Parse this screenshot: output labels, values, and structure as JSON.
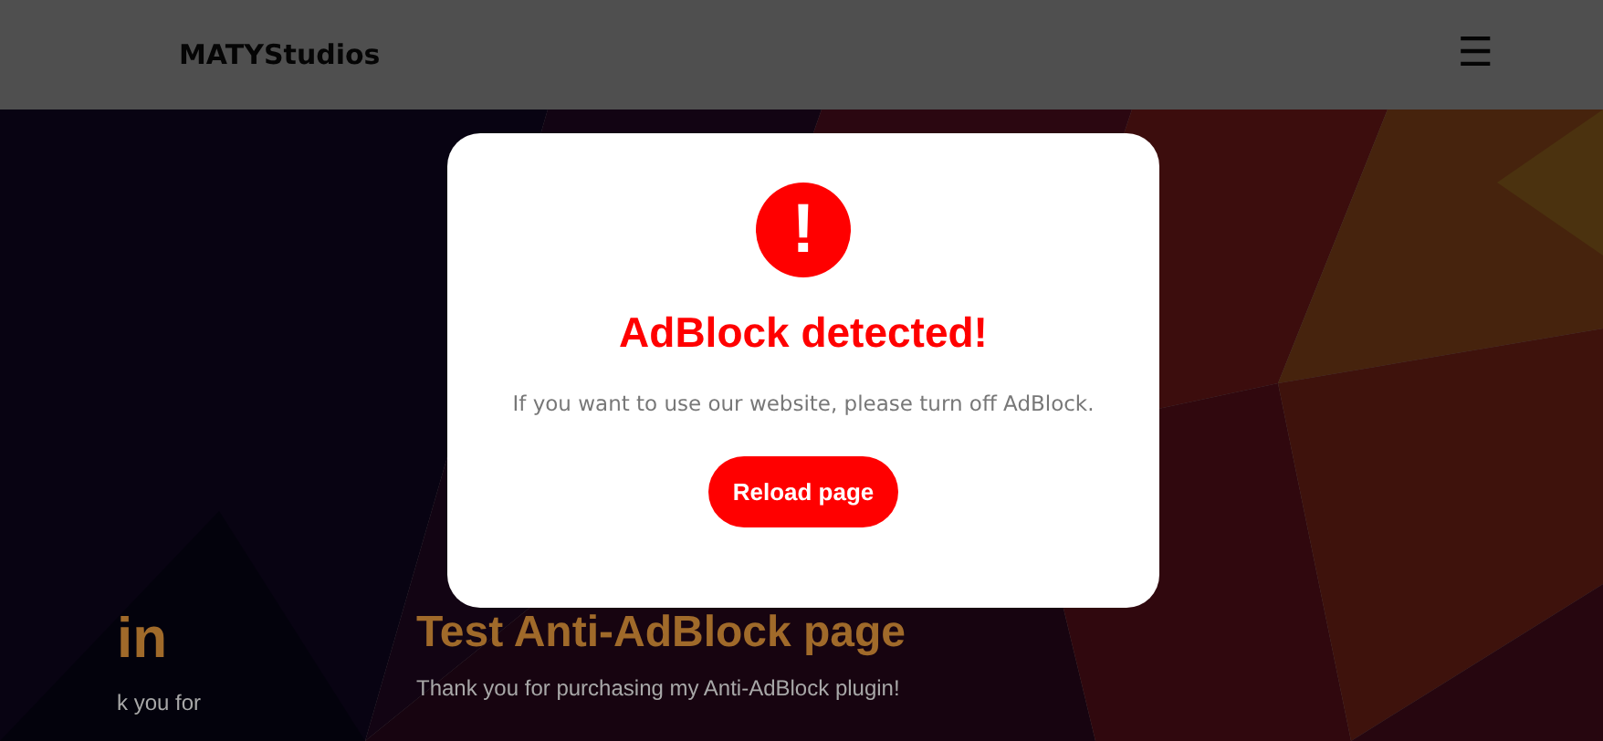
{
  "header": {
    "brand": "MATYStudios",
    "menu_icon": "☰"
  },
  "hero": {
    "left": {
      "heading": "in",
      "text": "k you for"
    },
    "right": {
      "heading": "Test Anti-AdBlock page",
      "text": "Thank you for purchasing my Anti-AdBlock plugin!"
    }
  },
  "modal": {
    "icon": "!",
    "title": "AdBlock detected!",
    "message": "If you want to use our website, please turn off AdBlock.",
    "button": "Reload page"
  }
}
